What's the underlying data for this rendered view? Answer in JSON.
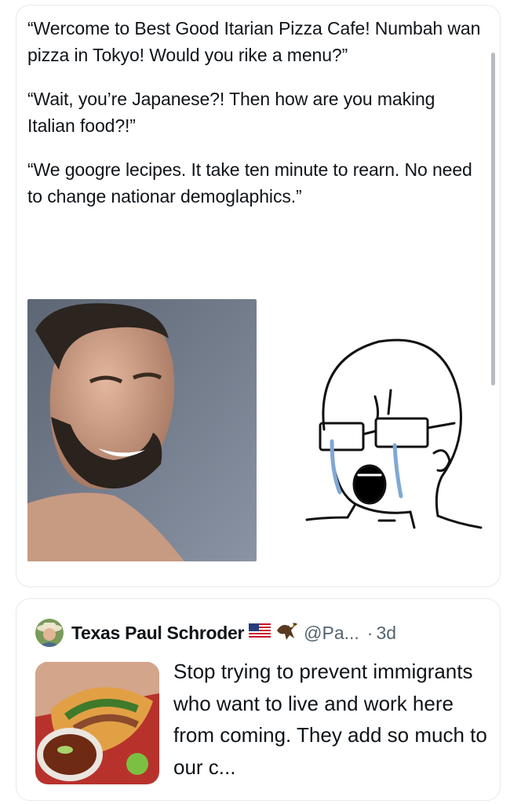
{
  "post": {
    "paragraphs": [
      "“Wercome to Best Good Itarian Pizza Cafe! Numbah wan pizza in Tokyo! Would you rike a menu?”",
      "“Wait, you’re Japanese?! Then how are you making Italian food?!”",
      "“We googre lecipes. It take ten minute to rearn. No need to change nationar demoglaphics.”"
    ],
    "media": [
      "bearded-man-photo",
      "crying-wojak-drawing"
    ]
  },
  "quote": {
    "author_name": "Texas Paul Schroder",
    "handle": "@Pa...",
    "dot": "·",
    "time": "3d",
    "text": "Stop trying to prevent immigrants who want to live and work here from coming. They add so much to our c...",
    "thumbnail": "tacos-photo"
  },
  "colors": {
    "text": "#0f1419",
    "secondary": "#536471",
    "border": "#e7e9ea"
  }
}
